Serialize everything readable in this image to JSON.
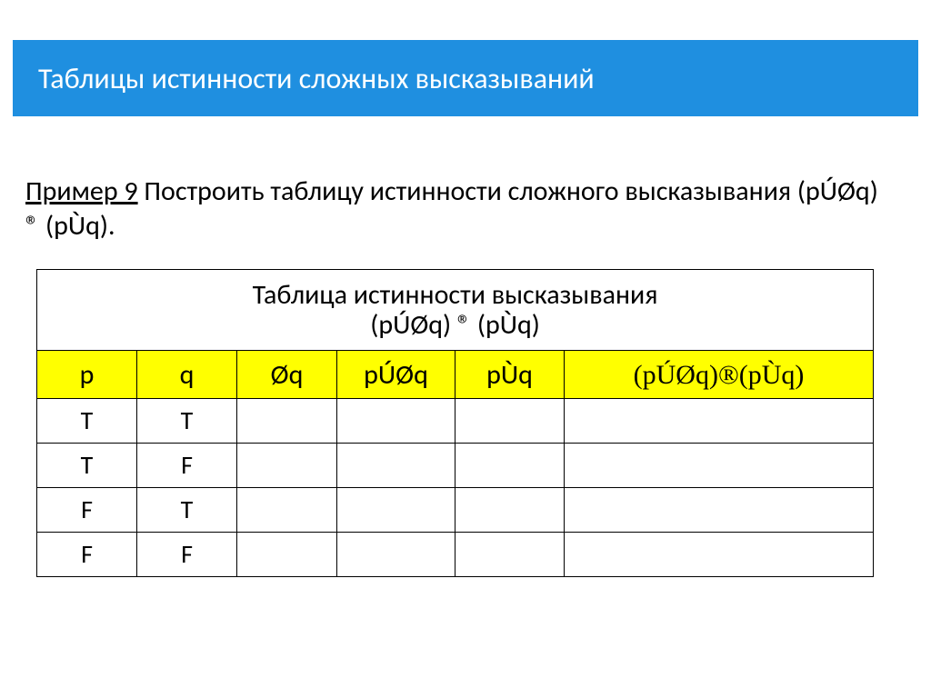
{
  "title": "Таблицы истинности сложных высказываний",
  "example": {
    "label": "Пример 9",
    "text_before": "  Построить таблицу истинности сложного высказывания   ",
    "formula": "(pÚØq) ® (pÙq).",
    "full": ""
  },
  "table": {
    "caption_line1": "Таблица истинности высказывания",
    "caption_line2": "(pÚØq) ® (pÙq)",
    "headers": {
      "p": "p",
      "q": "q",
      "not_q": "Øq",
      "p_or_notq": "pÚØq",
      "p_and_q": "pÙq",
      "final": "(pÚØq)®(pÙq)"
    },
    "rows": [
      {
        "p": "T",
        "q": "T",
        "not_q": "",
        "p_or_notq": "",
        "p_and_q": "",
        "final": ""
      },
      {
        "p": "T",
        "q": "F",
        "not_q": "",
        "p_or_notq": "",
        "p_and_q": "",
        "final": ""
      },
      {
        "p": "F",
        "q": "T",
        "not_q": "",
        "p_or_notq": "",
        "p_and_q": "",
        "final": ""
      },
      {
        "p": "F",
        "q": "F",
        "not_q": "",
        "p_or_notq": "",
        "p_and_q": "",
        "final": ""
      }
    ]
  },
  "chart_data": {
    "type": "table",
    "title": "Таблица истинности высказывания (pÚØq) ® (pÙq)",
    "columns": [
      "p",
      "q",
      "Øq",
      "pÚØq",
      "pÙq",
      "(pÚØq)®(pÙq)"
    ],
    "rows": [
      [
        "T",
        "T",
        "",
        "",
        "",
        ""
      ],
      [
        "T",
        "F",
        "",
        "",
        "",
        ""
      ],
      [
        "F",
        "T",
        "",
        "",
        "",
        ""
      ],
      [
        "F",
        "F",
        "",
        "",
        "",
        ""
      ]
    ]
  }
}
